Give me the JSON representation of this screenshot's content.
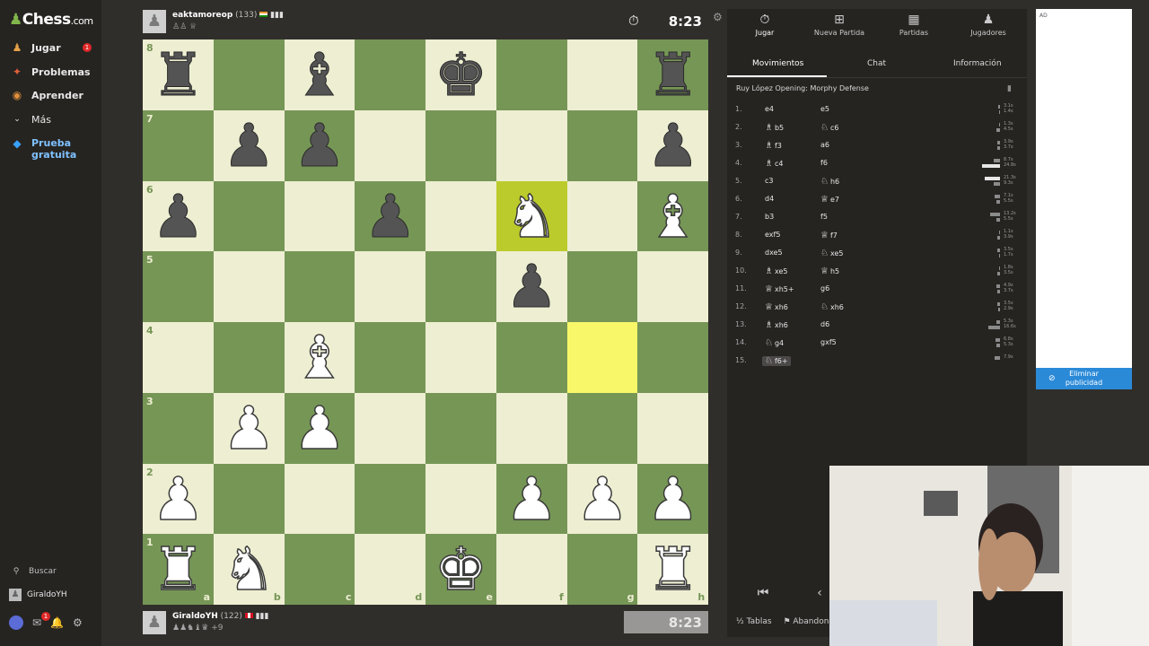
{
  "nav": {
    "logo_main": "Chess",
    "logo_suffix": ".com",
    "items": [
      {
        "label": "Jugar",
        "icon": "play-icon",
        "badge": "1"
      },
      {
        "label": "Problemas",
        "icon": "puzzle-icon"
      },
      {
        "label": "Aprender",
        "icon": "learn-icon"
      },
      {
        "label": "Más",
        "icon": "chevron-down-icon"
      },
      {
        "label": "Prueba gratuita",
        "icon": "diamond-icon"
      }
    ],
    "search_label": "Buscar",
    "username": "GiraldoYH",
    "mail_badge": "1"
  },
  "top_player": {
    "name": "eaktamoreop",
    "rating": "(133)",
    "clock": "8:23"
  },
  "bottom_player": {
    "name": "GiraldoYH",
    "rating": "(122)",
    "captured_extra": "+9",
    "clock": "8:23"
  },
  "board": {
    "files": [
      "a",
      "b",
      "c",
      "d",
      "e",
      "f",
      "g",
      "h"
    ],
    "ranks": [
      "8",
      "7",
      "6",
      "5",
      "4",
      "3",
      "2",
      "1"
    ],
    "light_color": "#eeeed2",
    "dark_color": "#769656",
    "highlight_color": "#f7f769",
    "pieces": [
      {
        "sq": "a8",
        "p": "r",
        "c": "b"
      },
      {
        "sq": "c8",
        "p": "b",
        "c": "b"
      },
      {
        "sq": "e8",
        "p": "k",
        "c": "b"
      },
      {
        "sq": "h8",
        "p": "r",
        "c": "b"
      },
      {
        "sq": "b7",
        "p": "p",
        "c": "b"
      },
      {
        "sq": "c7",
        "p": "p",
        "c": "b"
      },
      {
        "sq": "h7",
        "p": "p",
        "c": "b"
      },
      {
        "sq": "a6",
        "p": "p",
        "c": "b"
      },
      {
        "sq": "d6",
        "p": "p",
        "c": "b"
      },
      {
        "sq": "f6",
        "p": "n",
        "c": "w"
      },
      {
        "sq": "h6",
        "p": "b",
        "c": "w"
      },
      {
        "sq": "f5",
        "p": "p",
        "c": "b"
      },
      {
        "sq": "c4",
        "p": "b",
        "c": "w"
      },
      {
        "sq": "b3",
        "p": "p",
        "c": "w"
      },
      {
        "sq": "c3",
        "p": "p",
        "c": "w"
      },
      {
        "sq": "a2",
        "p": "p",
        "c": "w"
      },
      {
        "sq": "f2",
        "p": "p",
        "c": "w"
      },
      {
        "sq": "g2",
        "p": "p",
        "c": "w"
      },
      {
        "sq": "h2",
        "p": "p",
        "c": "w"
      },
      {
        "sq": "a1",
        "p": "r",
        "c": "w"
      },
      {
        "sq": "b1",
        "p": "n",
        "c": "w"
      },
      {
        "sq": "e1",
        "p": "k",
        "c": "w"
      },
      {
        "sq": "h1",
        "p": "r",
        "c": "w"
      }
    ],
    "last_move_from": "g4",
    "last_move_to": "f6"
  },
  "panel": {
    "tabs": [
      {
        "label": "Jugar",
        "icon": "clock-icon"
      },
      {
        "label": "Nueva Partida",
        "icon": "plus-icon"
      },
      {
        "label": "Partidas",
        "icon": "board-icon"
      },
      {
        "label": "Jugadores",
        "icon": "players-icon"
      }
    ],
    "subtabs": [
      "Movimientos",
      "Chat",
      "Información"
    ],
    "opening": "Ruy López Opening: Morphy Defense",
    "moves": [
      {
        "n": "1.",
        "w": "e4",
        "wp": "",
        "b": "e5",
        "bp": "",
        "t": [
          "3.1s",
          "1.4s"
        ]
      },
      {
        "n": "2.",
        "w": "b5",
        "wp": "B",
        "b": "c6",
        "bp": "N",
        "t": [
          "1.3s",
          "4.5s"
        ]
      },
      {
        "n": "3.",
        "w": "f3",
        "wp": "B",
        "b": "a6",
        "bp": "",
        "t": [
          "3.9s",
          "3.7s"
        ]
      },
      {
        "n": "4.",
        "w": "c4",
        "wp": "B",
        "b": "f6",
        "bp": "",
        "t": [
          "8.7s",
          "24.8s"
        ]
      },
      {
        "n": "5.",
        "w": "c3",
        "wp": "",
        "b": "h6",
        "bp": "N",
        "t": [
          "21.3s",
          "9.3s"
        ]
      },
      {
        "n": "6.",
        "w": "d4",
        "wp": "",
        "b": "e7",
        "bp": "Q",
        "t": [
          "7.1s",
          "5.5s"
        ]
      },
      {
        "n": "7.",
        "w": "b3",
        "wp": "",
        "b": "f5",
        "bp": "",
        "t": [
          "13.2s",
          "5.5s"
        ]
      },
      {
        "n": "8.",
        "w": "exf5",
        "wp": "",
        "b": "f7",
        "bp": "Q",
        "t": [
          "1.1s",
          "3.9s"
        ]
      },
      {
        "n": "9.",
        "w": "dxe5",
        "wp": "",
        "b": "xe5",
        "bp": "N",
        "t": [
          "3.5s",
          "1.7s"
        ]
      },
      {
        "n": "10.",
        "w": "xe5",
        "wp": "B",
        "b": "h5",
        "bp": "Q",
        "t": [
          "1.8s",
          "3.5s"
        ]
      },
      {
        "n": "11.",
        "w": "xh5+",
        "wp": "Q",
        "b": "g6",
        "bp": "",
        "t": [
          "4.9s",
          "3.7s"
        ]
      },
      {
        "n": "12.",
        "w": "xh6",
        "wp": "Q",
        "b": "xh6",
        "bp": "N",
        "t": [
          "3.5s",
          "2.9s"
        ]
      },
      {
        "n": "13.",
        "w": "xh6",
        "wp": "B",
        "b": "d6",
        "bp": "",
        "t": [
          "5.3s",
          "16.6s"
        ]
      },
      {
        "n": "14.",
        "w": "g4",
        "wp": "N",
        "b": "gxf5",
        "bp": "",
        "t": [
          "6.8s",
          "5.3s"
        ]
      },
      {
        "n": "15.",
        "w": "f6+",
        "wp": "N",
        "b": "",
        "bp": "",
        "t": [
          "7.9s",
          ""
        ]
      }
    ],
    "draw_label": "Tablas",
    "resign_label": "Abandonar"
  },
  "ad": {
    "label": "AD",
    "remove_label": "Eliminar publicidad"
  }
}
